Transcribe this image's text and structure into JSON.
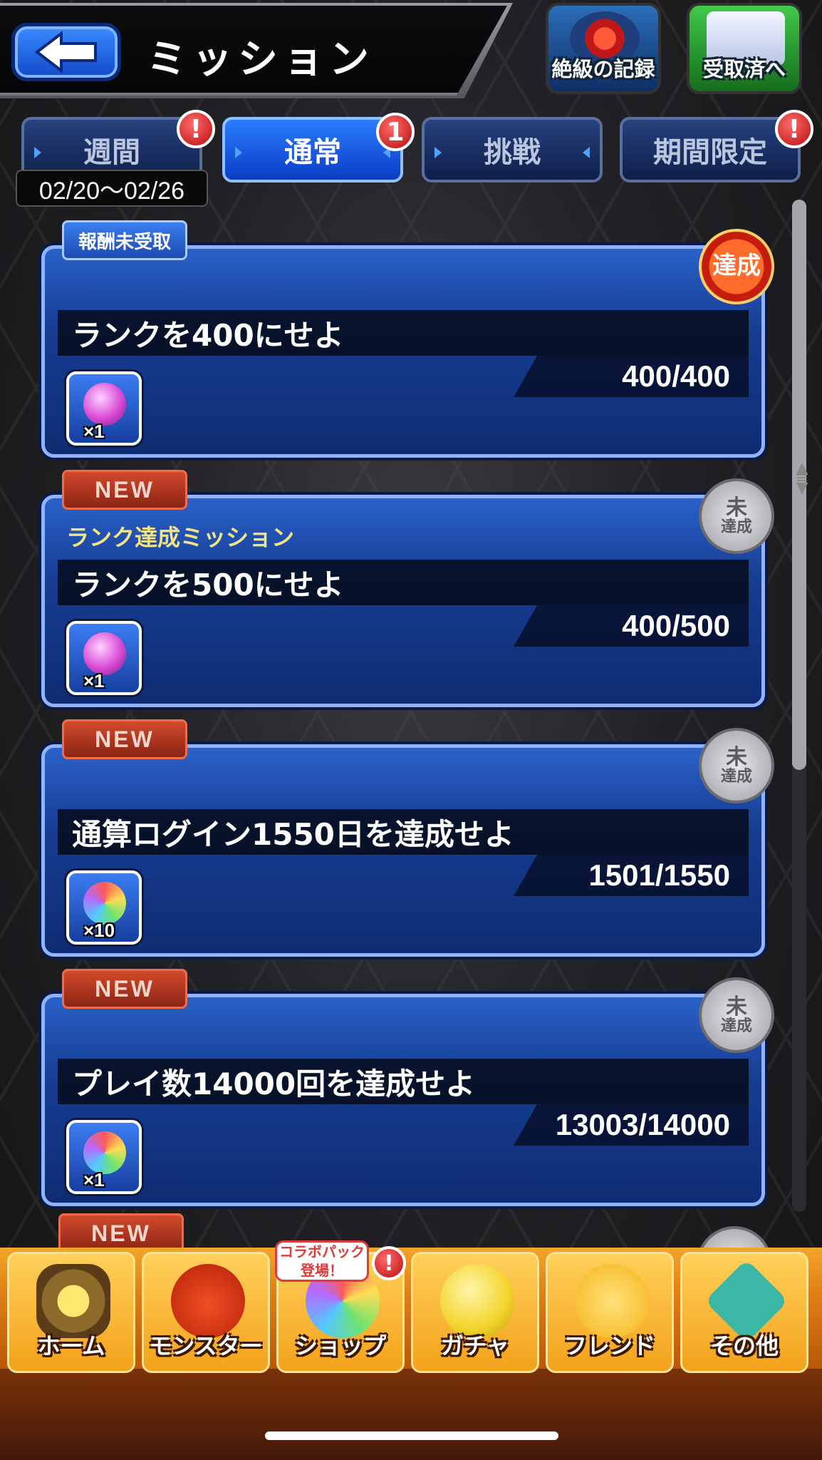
{
  "header": {
    "title": "ミッション",
    "record_label": "絶級の記録",
    "received_label": "受取済へ"
  },
  "tabs": [
    {
      "label": "週間",
      "badge": "!"
    },
    {
      "label": "通常",
      "badge": "1"
    },
    {
      "label": "挑戦",
      "badge": ""
    },
    {
      "label": "期間限定",
      "badge": "!"
    }
  ],
  "date_range": "02/20～02/26",
  "missions": [
    {
      "tag": "報酬未受取",
      "subtitle": "",
      "title": "ランクを400にせよ",
      "progress": "400/400",
      "reward_qty": "×1",
      "stamp": "達成"
    },
    {
      "tag": "NEW",
      "subtitle": "ランク達成ミッション",
      "title": "ランクを500にせよ",
      "progress": "400/500",
      "reward_qty": "×1",
      "stamp_top": "未",
      "stamp_bottom": "達成"
    },
    {
      "tag": "NEW",
      "subtitle": "",
      "title": "通算ログイン1550日を達成せよ",
      "progress": "1501/1550",
      "reward_qty": "×10",
      "stamp_top": "未",
      "stamp_bottom": "達成"
    },
    {
      "tag": "NEW",
      "subtitle": "",
      "title": "プレイ数14000回を達成せよ",
      "progress": "13003/14000",
      "reward_qty": "×1",
      "stamp_top": "未",
      "stamp_bottom": "達成"
    }
  ],
  "peek_tag": "NEW",
  "nav": {
    "home": "ホーム",
    "monster": "モンスター",
    "shop": "ショップ",
    "shop_bubble": "コラボパック 登場！",
    "shop_badge": "!",
    "gacha": "ガチャ",
    "friend": "フレンド",
    "other": "その他"
  },
  "icons": {
    "back": "back-arrow-icon",
    "record": "record-icon",
    "received": "received-icon"
  },
  "colors": {
    "card_blue": "#163d92",
    "tab_active": "#2a7cff",
    "nav_orange": "#f3a21b"
  }
}
